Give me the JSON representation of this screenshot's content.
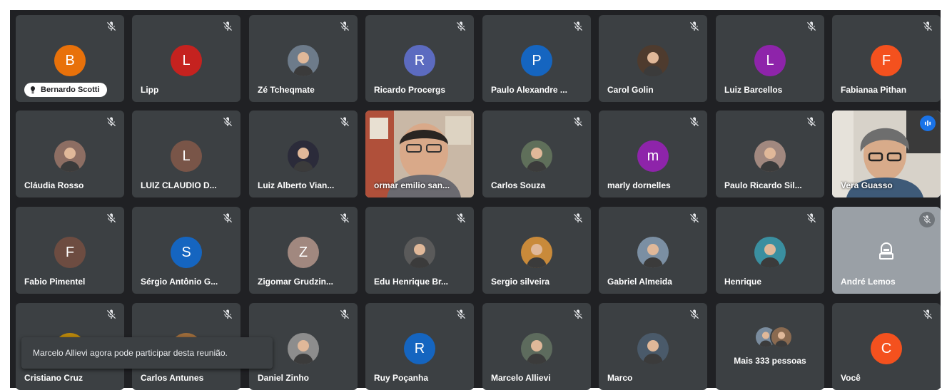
{
  "tiles": [
    {
      "name": "Bernardo Scotti",
      "initial": "B",
      "color": "#e8710a",
      "kind": "chip"
    },
    {
      "name": "Lipp",
      "initial": "L",
      "color": "#c5221f",
      "kind": "initial"
    },
    {
      "name": "Zé Tcheqmate",
      "initial": "",
      "color": "#6d7b8a",
      "kind": "photo"
    },
    {
      "name": "Ricardo Procergs",
      "initial": "R",
      "color": "#5c6bc0",
      "kind": "initial"
    },
    {
      "name": "Paulo Alexandre ...",
      "initial": "P",
      "color": "#1565c0",
      "kind": "initial"
    },
    {
      "name": "Carol Golin",
      "initial": "",
      "color": "#4e3b2e",
      "kind": "photo"
    },
    {
      "name": "Luiz Barcellos",
      "initial": "L",
      "color": "#8e24aa",
      "kind": "initial"
    },
    {
      "name": "Fabianaa Pithan",
      "initial": "F",
      "color": "#f4511e",
      "kind": "initial"
    },
    {
      "name": "Cláudia Rosso",
      "initial": "",
      "color": "#8d6e63",
      "kind": "photo"
    },
    {
      "name": "LUIZ CLAUDIO D...",
      "initial": "L",
      "color": "#795548",
      "kind": "initial"
    },
    {
      "name": "Luiz Alberto Vian...",
      "initial": "",
      "color": "#2b2b3a",
      "kind": "photo"
    },
    {
      "name": "ormar emilio san...",
      "initial": "",
      "color": "",
      "kind": "video"
    },
    {
      "name": "Carlos Souza",
      "initial": "",
      "color": "#5f6f5a",
      "kind": "photo"
    },
    {
      "name": "marly dornelles",
      "initial": "m",
      "color": "#8e24aa",
      "kind": "initial"
    },
    {
      "name": "Paulo Ricardo Sil...",
      "initial": "",
      "color": "#a1887f",
      "kind": "photo"
    },
    {
      "name": "Vera Guasso",
      "initial": "",
      "color": "",
      "kind": "video2"
    },
    {
      "name": "Fabio Pimentel",
      "initial": "F",
      "color": "#6d4c41",
      "kind": "initial"
    },
    {
      "name": "Sérgio Antônio G...",
      "initial": "S",
      "color": "#1565c0",
      "kind": "initial"
    },
    {
      "name": "Zigomar Grudzin...",
      "initial": "Z",
      "color": "#a1887f",
      "kind": "initial"
    },
    {
      "name": "Edu Henrique Br...",
      "initial": "",
      "color": "#5a5a5a",
      "kind": "photo"
    },
    {
      "name": "Sergio silveira",
      "initial": "",
      "color": "#c98a3a",
      "kind": "photo"
    },
    {
      "name": "Gabriel Almeida",
      "initial": "",
      "color": "#7b8fa3",
      "kind": "photo"
    },
    {
      "name": "Henrique",
      "initial": "",
      "color": "#3a8fa0",
      "kind": "photo"
    },
    {
      "name": "André Lemos",
      "initial": "",
      "color": "",
      "kind": "ghost"
    },
    {
      "name": "Cristiano Cruz",
      "initial": "",
      "color": "#b8860b",
      "kind": "photo"
    },
    {
      "name": "Carlos Antunes",
      "initial": "",
      "color": "#9c6b3a",
      "kind": "photo"
    },
    {
      "name": "Daniel Zinho",
      "initial": "",
      "color": "#8d8d8d",
      "kind": "photo"
    },
    {
      "name": "Ruy Poçanha",
      "initial": "R",
      "color": "#1565c0",
      "kind": "initial"
    },
    {
      "name": "Marcelo Allievi",
      "initial": "",
      "color": "#5d6b5d",
      "kind": "photo"
    },
    {
      "name": "Marco",
      "initial": "",
      "color": "#4a5a6a",
      "kind": "photo"
    },
    {
      "name": "",
      "initial": "",
      "color": "",
      "kind": "more",
      "label": "Mais 333 pessoas"
    },
    {
      "name": "Você",
      "initial": "C",
      "color": "#f4511e",
      "kind": "initial"
    }
  ],
  "toast": {
    "text": "Marcelo Allievi agora pode participar desta reunião."
  }
}
